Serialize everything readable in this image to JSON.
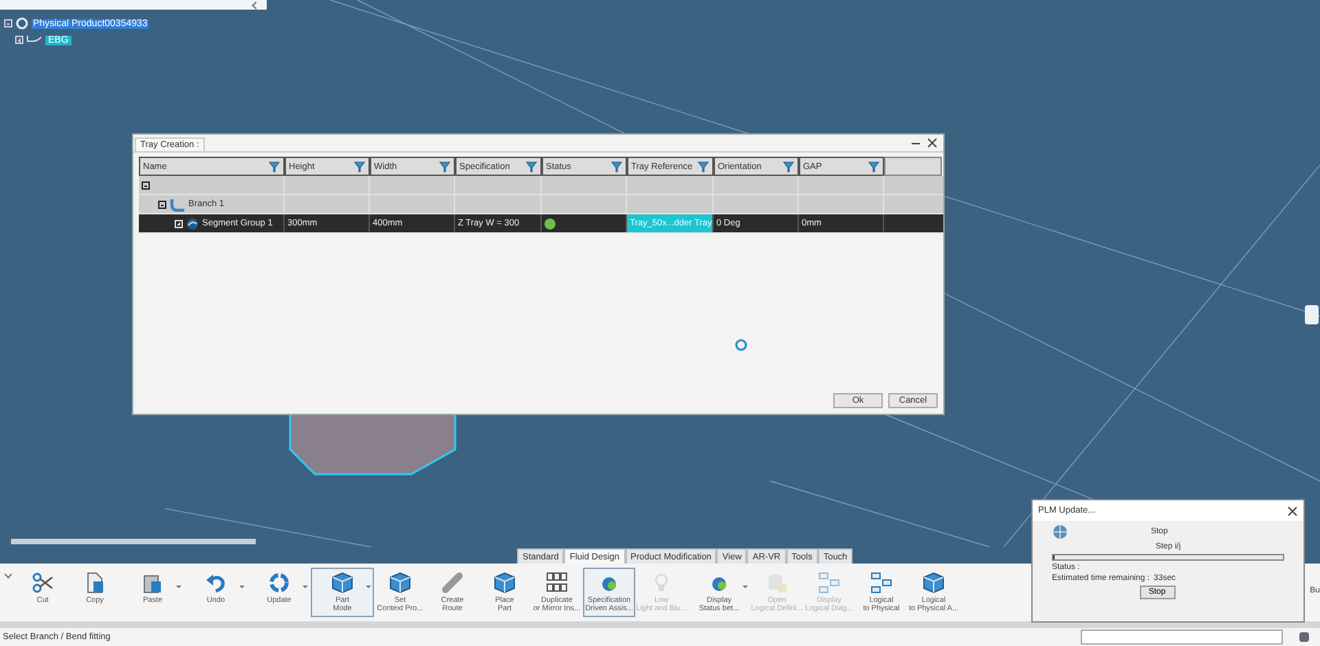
{
  "tree": {
    "root": {
      "label": "Physical Product00354933",
      "selected": true,
      "expanded": true
    },
    "children": [
      {
        "label": "EBG",
        "expanded": false
      }
    ]
  },
  "dialog": {
    "title": "Tray Creation :",
    "columns": [
      "Name",
      "Height",
      "Width",
      "Specification",
      "Status",
      "Tray Reference",
      "Orientation",
      "GAP"
    ],
    "rows": [
      {
        "expanded": true,
        "selected": false,
        "children": [
          {
            "name": "Branch 1",
            "expanded": true,
            "selected": false,
            "children": [
              {
                "name": "Segment Group 1",
                "selected": false,
                "expanded": false,
                "highlighted": true,
                "color": "#6cc04a",
                "cells": {
                  "height": "300mm",
                  "width": "400mm",
                  "specification": "Z Tray W = 300",
                  "tray_reference": "Tray_50x...dder Tray",
                  "orientation": "0 Deg",
                  "gap": "0mm"
                }
              }
            ]
          }
        ]
      }
    ],
    "buttons": [
      "Ok",
      "Cancel"
    ]
  },
  "tabs": [
    {
      "label": "Standard",
      "selected": false
    },
    {
      "label": "Fluid Design",
      "selected": true
    },
    {
      "label": "Product Modification",
      "selected": false
    },
    {
      "label": "View",
      "selected": false
    },
    {
      "label": "AR-VR",
      "selected": false
    },
    {
      "label": "Tools",
      "selected": false
    },
    {
      "label": "Touch",
      "selected": false
    }
  ],
  "toolbar": [
    {
      "lines": [
        "Cut"
      ],
      "kind": "plain",
      "selected": false,
      "disabled": false
    },
    {
      "lines": [
        "Copy"
      ],
      "kind": "plain",
      "selected": false,
      "disabled": false
    },
    {
      "lines": [
        "Paste"
      ],
      "kind": "split",
      "selected": false,
      "disabled": false
    },
    {
      "lines": [
        "Undo"
      ],
      "kind": "split",
      "selected": false,
      "disabled": false
    },
    {
      "lines": [
        "Update"
      ],
      "kind": "split",
      "selected": false,
      "disabled": false
    },
    {
      "lines": [
        "Part",
        "Mode"
      ],
      "kind": "split",
      "selected": true,
      "disabled": false
    },
    {
      "lines": [
        "Set",
        "Context Pro..."
      ],
      "kind": "plain",
      "selected": false,
      "disabled": false
    },
    {
      "lines": [
        "Create",
        "Route"
      ],
      "kind": "plain",
      "selected": false,
      "disabled": false
    },
    {
      "lines": [
        "Place",
        "Part"
      ],
      "kind": "plain",
      "selected": false,
      "disabled": false
    },
    {
      "lines": [
        "Duplicate",
        "or Mirror Ins..."
      ],
      "kind": "plain",
      "selected": false,
      "disabled": false
    },
    {
      "lines": [
        "Specification",
        "Driven Assis..."
      ],
      "kind": "plain",
      "selected": true,
      "disabled": false
    },
    {
      "lines": [
        "Low",
        "Light and Blu..."
      ],
      "kind": "plain",
      "selected": false,
      "disabled": true
    },
    {
      "lines": [
        "Display",
        "Status bet..."
      ],
      "kind": "split",
      "selected": false,
      "disabled": false
    },
    {
      "lines": [
        "Open",
        "Logical Defini..."
      ],
      "kind": "plain",
      "selected": false,
      "disabled": true
    },
    {
      "lines": [
        "Display",
        "Logical Diag..."
      ],
      "kind": "plain",
      "selected": false,
      "disabled": true
    },
    {
      "lines": [
        "Logical",
        "to Physical"
      ],
      "kind": "plain",
      "selected": false,
      "disabled": false
    },
    {
      "lines": [
        "Logical",
        "to Physical A..."
      ],
      "kind": "plain",
      "selected": false,
      "disabled": false
    },
    {
      "lines": [
        "Bu"
      ],
      "kind": "cut"
    }
  ],
  "status_bar": {
    "message": "Select Branch / Bend fitting"
  },
  "plm_dialog": {
    "title": "PLM Update...",
    "heading": "Stop",
    "step": "Step i/j",
    "level": 0,
    "status_label": "Status :",
    "time_label": "Estimated time remaining :",
    "time_value": "33sec",
    "button": "Stop"
  }
}
